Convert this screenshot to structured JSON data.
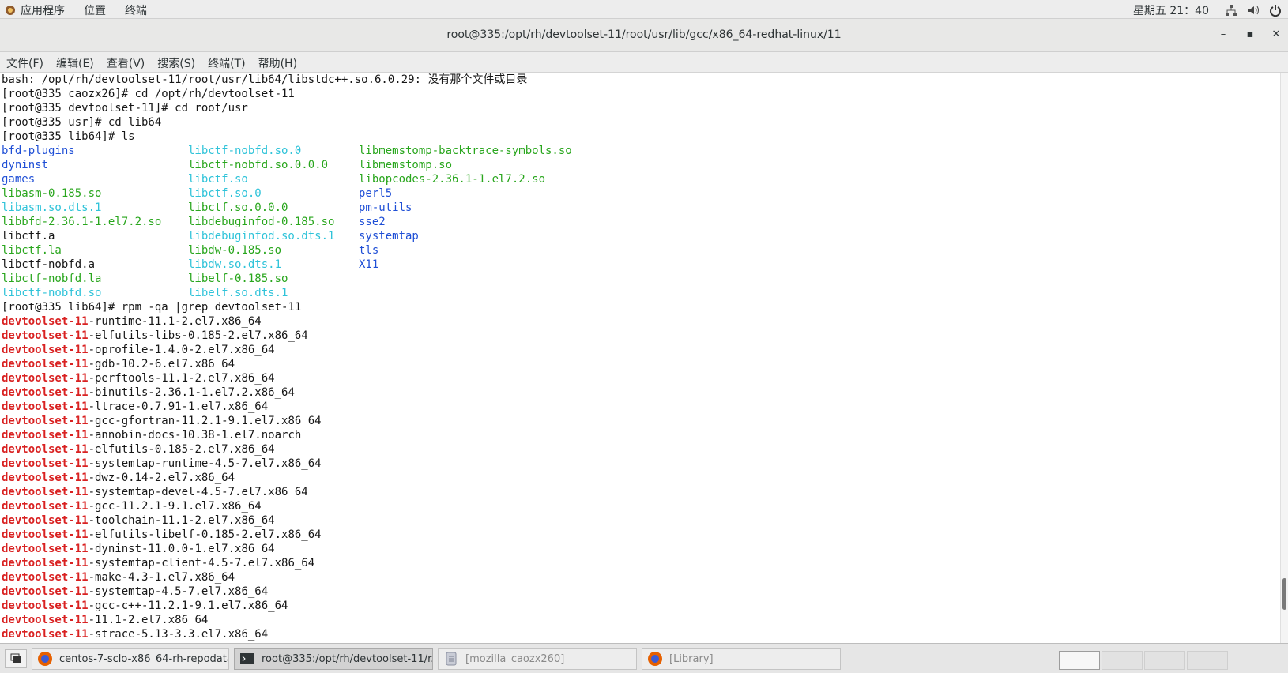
{
  "topbar": {
    "menus": [
      "应用程序",
      "位置",
      "终端"
    ],
    "clock": "星期五 21：40"
  },
  "window": {
    "title": "root@335:/opt/rh/devtoolset-11/root/usr/lib/gcc/x86_64-redhat-linux/11",
    "minimize": "–",
    "maximize": "▪",
    "close": "✕"
  },
  "menubar": [
    "文件(F)",
    "编辑(E)",
    "查看(V)",
    "搜索(S)",
    "终端(T)",
    "帮助(H)"
  ],
  "terminal": {
    "pre_lines": [
      "bash: /opt/rh/devtoolset-11/root/usr/lib64/libstdc++.so.6.0.29: 没有那个文件或目录",
      "[root@335 caozx26]# cd /opt/rh/devtoolset-11",
      "[root@335 devtoolset-11]# cd root/usr",
      "[root@335 usr]# cd lib64",
      "[root@335 lib64]# ls"
    ],
    "ls_rows": [
      [
        {
          "t": "bfd-plugins",
          "c": "blue"
        },
        {
          "t": "libctf-nobfd.so.0",
          "c": "cyan"
        },
        {
          "t": "libmemstomp-backtrace-symbols.so",
          "c": "green"
        }
      ],
      [
        {
          "t": "dyninst",
          "c": "blue"
        },
        {
          "t": "libctf-nobfd.so.0.0.0",
          "c": "green"
        },
        {
          "t": "libmemstomp.so",
          "c": "green"
        }
      ],
      [
        {
          "t": "games",
          "c": "blue"
        },
        {
          "t": "libctf.so",
          "c": "cyan"
        },
        {
          "t": "libopcodes-2.36.1-1.el7.2.so",
          "c": "green"
        }
      ],
      [
        {
          "t": "libasm-0.185.so",
          "c": "green"
        },
        {
          "t": "libctf.so.0",
          "c": "cyan"
        },
        {
          "t": "perl5",
          "c": "blue"
        }
      ],
      [
        {
          "t": "libasm.so.dts.1",
          "c": "cyan"
        },
        {
          "t": "libctf.so.0.0.0",
          "c": "green"
        },
        {
          "t": "pm-utils",
          "c": "blue"
        }
      ],
      [
        {
          "t": "libbfd-2.36.1-1.el7.2.so",
          "c": "green"
        },
        {
          "t": "libdebuginfod-0.185.so",
          "c": "green"
        },
        {
          "t": "sse2",
          "c": "blue"
        }
      ],
      [
        {
          "t": "libctf.a",
          "c": ""
        },
        {
          "t": "libdebuginfod.so.dts.1",
          "c": "cyan"
        },
        {
          "t": "systemtap",
          "c": "blue"
        }
      ],
      [
        {
          "t": "libctf.la",
          "c": "green"
        },
        {
          "t": "libdw-0.185.so",
          "c": "green"
        },
        {
          "t": "tls",
          "c": "blue"
        }
      ],
      [
        {
          "t": "libctf-nobfd.a",
          "c": ""
        },
        {
          "t": "libdw.so.dts.1",
          "c": "cyan"
        },
        {
          "t": "X11",
          "c": "blue"
        }
      ],
      [
        {
          "t": "libctf-nobfd.la",
          "c": "green"
        },
        {
          "t": "libelf-0.185.so",
          "c": "green"
        },
        {
          "t": "",
          "c": ""
        }
      ],
      [
        {
          "t": "libctf-nobfd.so",
          "c": "cyan"
        },
        {
          "t": "libelf.so.dts.1",
          "c": "cyan"
        },
        {
          "t": "",
          "c": ""
        }
      ]
    ],
    "rpm_cmd": "[root@335 lib64]# rpm -qa |grep devtoolset-11",
    "pkg_prefix": "devtoolset-11",
    "packages": [
      "-runtime-11.1-2.el7.x86_64",
      "-elfutils-libs-0.185-2.el7.x86_64",
      "-oprofile-1.4.0-2.el7.x86_64",
      "-gdb-10.2-6.el7.x86_64",
      "-perftools-11.1-2.el7.x86_64",
      "-binutils-2.36.1-1.el7.2.x86_64",
      "-ltrace-0.7.91-1.el7.x86_64",
      "-gcc-gfortran-11.2.1-9.1.el7.x86_64",
      "-annobin-docs-10.38-1.el7.noarch",
      "-elfutils-0.185-2.el7.x86_64",
      "-systemtap-runtime-4.5-7.el7.x86_64",
      "-dwz-0.14-2.el7.x86_64",
      "-systemtap-devel-4.5-7.el7.x86_64",
      "-gcc-11.2.1-9.1.el7.x86_64",
      "-toolchain-11.1-2.el7.x86_64",
      "-elfutils-libelf-0.185-2.el7.x86_64",
      "-dyninst-11.0.0-1.el7.x86_64",
      "-systemtap-client-4.5-7.el7.x86_64",
      "-make-4.3-1.el7.x86_64",
      "-systemtap-4.5-7.el7.x86_64",
      "-gcc-c++-11.2.1-9.1.el7.x86_64",
      "-11.1-2.el7.x86_64",
      "-strace-5.13-3.3.el7.x86_64"
    ]
  },
  "taskbar": {
    "tasks": [
      {
        "label": "centos-7-sclo-x86_64-rh-repodata...",
        "icon": "firefox-icon"
      },
      {
        "label": "root@335:/opt/rh/devtoolset-11/r...",
        "icon": "terminal-icon"
      },
      {
        "label": "[mozilla_caozx260]",
        "icon": "document-icon"
      },
      {
        "label": "[Library]",
        "icon": "firefox-icon"
      }
    ]
  },
  "colors": {
    "dir": "#1f4fd6",
    "symlink": "#2fc3d9",
    "executable": "#29a61d",
    "grep_match": "#d92121"
  }
}
